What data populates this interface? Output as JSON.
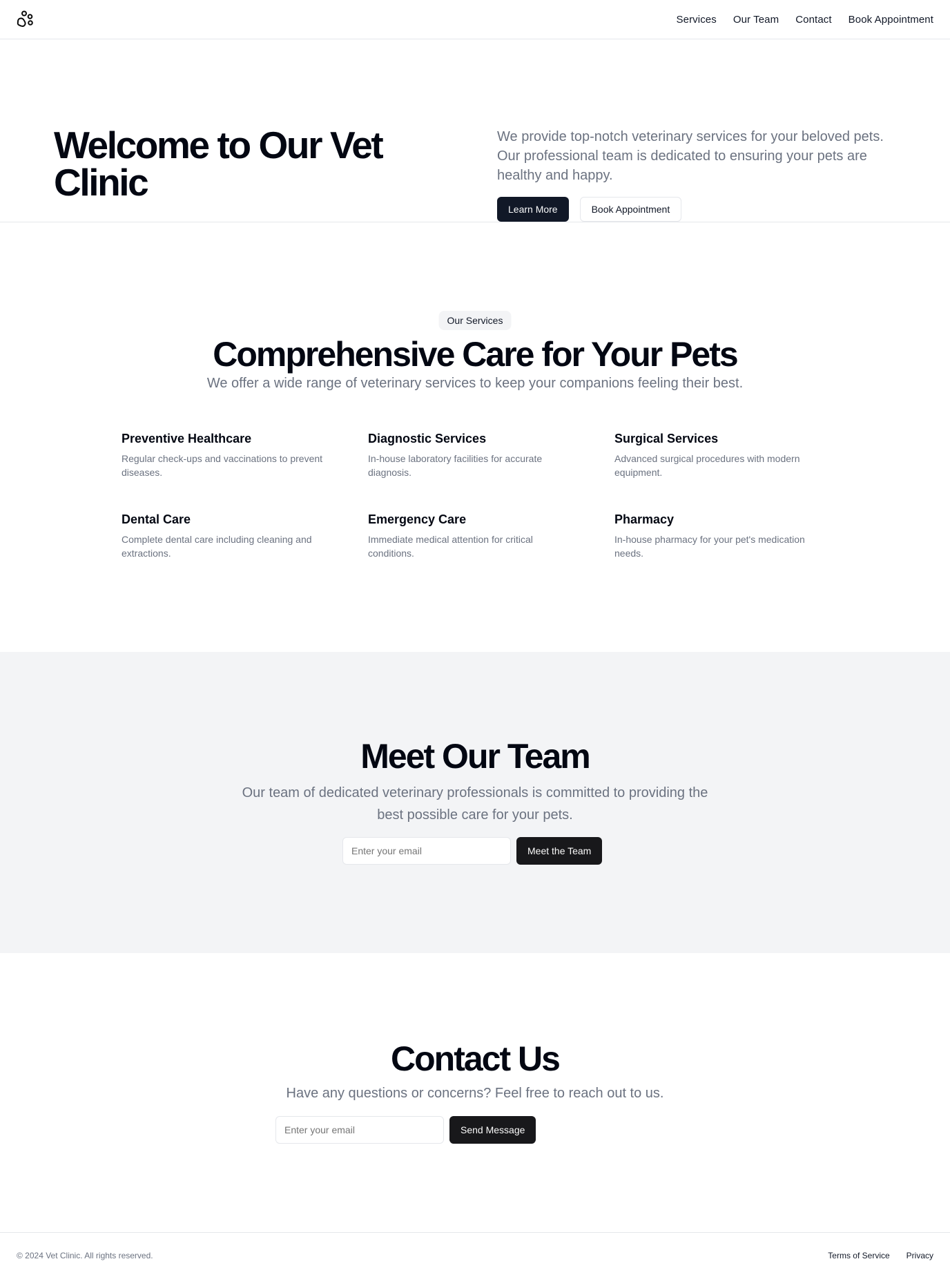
{
  "header": {
    "logo_icon": "paw-icon",
    "nav": [
      "Services",
      "Our Team",
      "Contact",
      "Book Appointment"
    ]
  },
  "hero": {
    "title": "Welcome to Our Vet Clinic",
    "description": "We provide top-notch veterinary services for your beloved pets. Our professional team is dedicated to ensuring your pets are healthy and happy.",
    "primary_button": "Learn More",
    "secondary_button": "Book Appointment"
  },
  "services": {
    "badge": "Our Services",
    "title": "Comprehensive Care for Your Pets",
    "subtitle": "We offer a wide range of veterinary services to keep your companions feeling their best.",
    "items": [
      {
        "title": "Preventive Healthcare",
        "desc": "Regular check-ups and vaccinations to prevent diseases."
      },
      {
        "title": "Diagnostic Services",
        "desc": "In-house laboratory facilities for accurate diagnosis."
      },
      {
        "title": "Surgical Services",
        "desc": "Advanced surgical procedures with modern equipment."
      },
      {
        "title": "Dental Care",
        "desc": "Complete dental care including cleaning and extractions."
      },
      {
        "title": "Emergency Care",
        "desc": "Immediate medical attention for critical conditions."
      },
      {
        "title": "Pharmacy",
        "desc": "In-house pharmacy for your pet's medication needs."
      }
    ]
  },
  "team": {
    "title": "Meet Our Team",
    "subtitle": "Our team of dedicated veterinary professionals is committed to providing the best possible care for your pets.",
    "email_placeholder": "Enter your email",
    "button": "Meet the Team"
  },
  "contact": {
    "title": "Contact Us",
    "subtitle": "Have any questions or concerns? Feel free to reach out to us.",
    "email_placeholder": "Enter your email",
    "button": "Send Message"
  },
  "footer": {
    "copyright": "© 2024 Vet Clinic. All rights reserved.",
    "links": [
      "Terms of Service",
      "Privacy"
    ]
  },
  "colors": {
    "primary_dark": "#111827",
    "muted_text": "#6b7280",
    "section_bg": "#f3f4f6",
    "border": "#e5e7eb"
  }
}
